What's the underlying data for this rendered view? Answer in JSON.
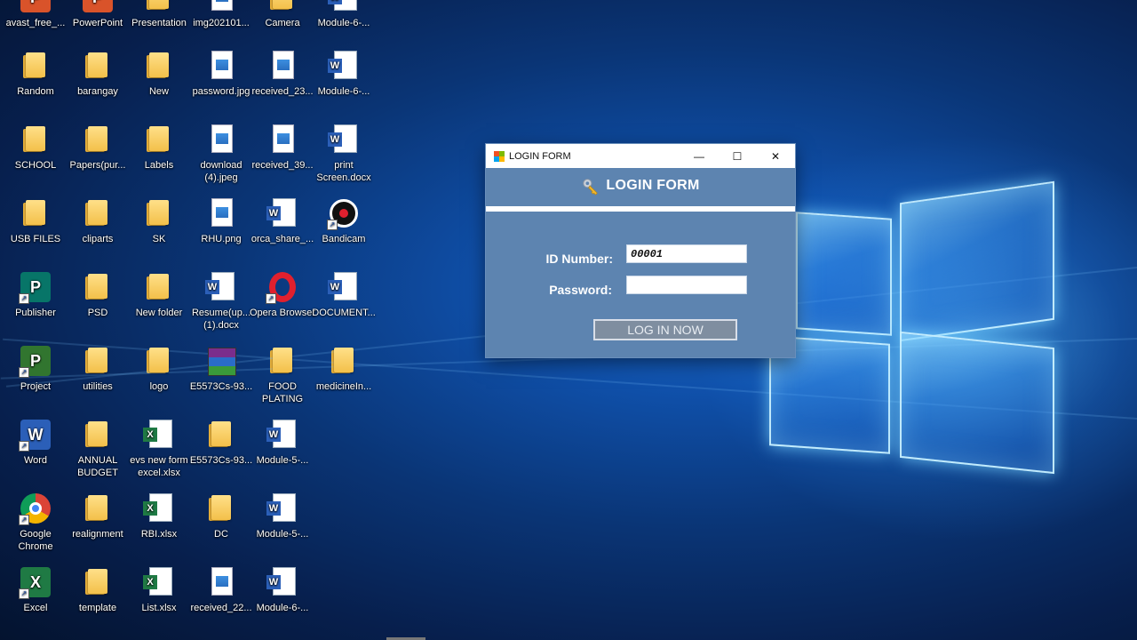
{
  "desktop": {
    "icons": [
      {
        "label": "avast_free_...",
        "type": "app-orange"
      },
      {
        "label": "PowerPoint",
        "type": "app-orange"
      },
      {
        "label": "Presentation",
        "type": "folder"
      },
      {
        "label": "img202101...",
        "type": "image"
      },
      {
        "label": "Camera",
        "type": "folder"
      },
      {
        "label": "Module-6-...",
        "type": "doc"
      },
      {
        "label": "Random",
        "type": "folder"
      },
      {
        "label": "barangay",
        "type": "folder"
      },
      {
        "label": "New",
        "type": "folder"
      },
      {
        "label": "password.jpg",
        "type": "image"
      },
      {
        "label": "received_23...",
        "type": "image"
      },
      {
        "label": "Module-6-...",
        "type": "doc"
      },
      {
        "label": "SCHOOL",
        "type": "folder"
      },
      {
        "label": "Papers(pur...",
        "type": "folder"
      },
      {
        "label": "Labels",
        "type": "folder"
      },
      {
        "label": "download (4).jpeg",
        "type": "image"
      },
      {
        "label": "received_39...",
        "type": "image"
      },
      {
        "label": "print Screen.docx",
        "type": "doc"
      },
      {
        "label": "USB FILES",
        "type": "folder"
      },
      {
        "label": "cliparts",
        "type": "folder"
      },
      {
        "label": "SK",
        "type": "folder"
      },
      {
        "label": "RHU.png",
        "type": "image"
      },
      {
        "label": "orca_share_...",
        "type": "doc"
      },
      {
        "label": "Bandicam",
        "type": "bandicam"
      },
      {
        "label": "Publisher",
        "type": "publisher"
      },
      {
        "label": "PSD",
        "type": "folder"
      },
      {
        "label": "New folder",
        "type": "folder"
      },
      {
        "label": "Resume(up... (1).docx",
        "type": "doc"
      },
      {
        "label": "Opera Browser",
        "type": "opera"
      },
      {
        "label": "DOCUMENT...",
        "type": "doc"
      },
      {
        "label": "Project",
        "type": "project"
      },
      {
        "label": "utilities",
        "type": "folder"
      },
      {
        "label": "logo",
        "type": "folder"
      },
      {
        "label": "E5573Cs-93...",
        "type": "rar"
      },
      {
        "label": "FOOD PLATING",
        "type": "folder"
      },
      {
        "label": "medicineIn...",
        "type": "folder"
      },
      {
        "label": "Word",
        "type": "word"
      },
      {
        "label": "ANNUAL BUDGET",
        "type": "folder"
      },
      {
        "label": "evs new form excel.xlsx",
        "type": "excel"
      },
      {
        "label": "E5573Cs-93...",
        "type": "folder"
      },
      {
        "label": "Module-5-...",
        "type": "doc"
      },
      {
        "label": "Google Chrome",
        "type": "chrome"
      },
      {
        "label": "realignment",
        "type": "folder"
      },
      {
        "label": "RBI.xlsx",
        "type": "excel"
      },
      {
        "label": "DC",
        "type": "folder"
      },
      {
        "label": "Module-5-...",
        "type": "doc"
      },
      {
        "label": "Excel",
        "type": "excel-app"
      },
      {
        "label": "template",
        "type": "folder"
      },
      {
        "label": "List.xlsx",
        "type": "excel"
      },
      {
        "label": "received_22...",
        "type": "image"
      },
      {
        "label": "Module-6-...",
        "type": "doc"
      }
    ]
  },
  "login_window": {
    "title": "LOGIN FORM",
    "header": "LOGIN FORM",
    "id_label": "ID Number:",
    "id_value": "00001",
    "password_label": "Password:",
    "password_value": "",
    "login_button": "LOG IN NOW",
    "minimize_glyph": "—",
    "maximize_glyph": "☐",
    "close_glyph": "✕"
  },
  "colors": {
    "window_body": "#5d84b0",
    "button_bg": "#7f8ea0",
    "excel_green": "#1f7a44",
    "word_blue": "#2b5fb8"
  }
}
